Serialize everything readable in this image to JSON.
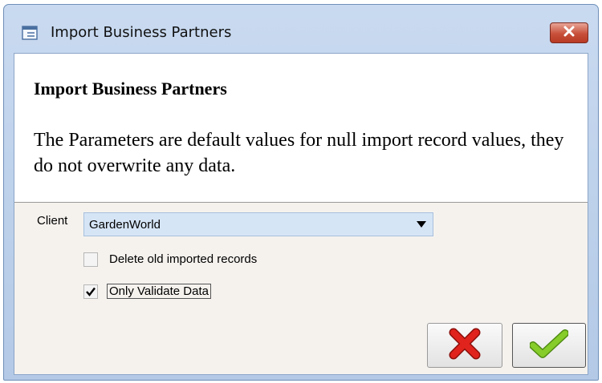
{
  "window": {
    "title": "Import Business Partners",
    "icons": {
      "app": "window-form-icon",
      "close": "close-x-icon"
    }
  },
  "header": {
    "title": "Import Business Partners",
    "description": "The Parameters are default values for null import record values, they do not overwrite any data."
  },
  "params": {
    "client_label": "Client",
    "client_value": "GardenWorld",
    "delete_old_label": "Delete old imported records",
    "delete_old_checked": false,
    "validate_label": "Only Validate Data",
    "validate_checked": true
  },
  "buttons": {
    "cancel_icon": "red-x-icon",
    "ok_icon": "green-check-icon"
  },
  "colors": {
    "titlebar": "#c4d7ef",
    "close": "#c8503a",
    "select_bg": "#d6e5f6",
    "params_bg": "#f5f2ee",
    "cancel_icon": "#e0231c",
    "ok_icon": "#7cc31f"
  }
}
